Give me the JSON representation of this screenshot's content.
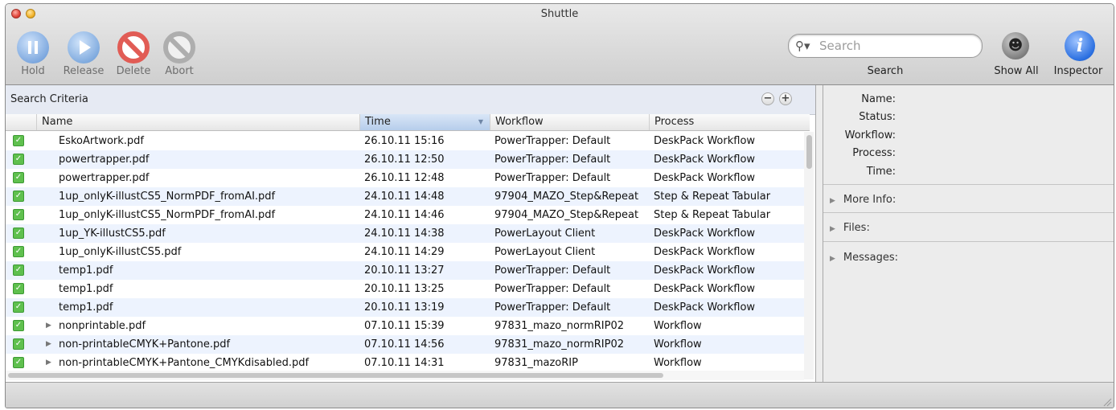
{
  "window": {
    "title": "Shuttle"
  },
  "toolbar": {
    "hold_label": "Hold",
    "release_label": "Release",
    "delete_label": "Delete",
    "abort_label": "Abort",
    "search_label": "Search",
    "search_placeholder": "Search",
    "show_all_label": "Show All",
    "inspector_label": "Inspector"
  },
  "search_criteria": {
    "label": "Search Criteria"
  },
  "table": {
    "columns": [
      "Name",
      "Time",
      "Workflow",
      "Process"
    ],
    "sorted_column": "Time",
    "rows": [
      {
        "checked": true,
        "expandable": false,
        "name": "EskoArtwork.pdf",
        "time": "26.10.11 15:16",
        "workflow": "PowerTrapper: Default",
        "process": "DeskPack Workflow"
      },
      {
        "checked": true,
        "expandable": false,
        "name": "powertrapper.pdf",
        "time": "26.10.11 12:50",
        "workflow": "PowerTrapper: Default",
        "process": "DeskPack Workflow"
      },
      {
        "checked": true,
        "expandable": false,
        "name": "powertrapper.pdf",
        "time": "26.10.11 12:48",
        "workflow": "PowerTrapper: Default",
        "process": "DeskPack Workflow"
      },
      {
        "checked": true,
        "expandable": false,
        "name": "1up_onlyK-illustCS5_NormPDF_fromAI.pdf",
        "time": "24.10.11 14:48",
        "workflow": "97904_MAZO_Step&Repeat",
        "process": "Step & Repeat Tabular"
      },
      {
        "checked": true,
        "expandable": false,
        "name": "1up_onlyK-illustCS5_NormPDF_fromAI.pdf",
        "time": "24.10.11 14:46",
        "workflow": "97904_MAZO_Step&Repeat",
        "process": "Step & Repeat Tabular"
      },
      {
        "checked": true,
        "expandable": false,
        "name": "1up_YK-illustCS5.pdf",
        "time": "24.10.11 14:38",
        "workflow": "PowerLayout Client",
        "process": "DeskPack Workflow"
      },
      {
        "checked": true,
        "expandable": false,
        "name": "1up_onlyK-illustCS5.pdf",
        "time": "24.10.11 14:29",
        "workflow": "PowerLayout Client",
        "process": "DeskPack Workflow"
      },
      {
        "checked": true,
        "expandable": false,
        "name": "temp1.pdf",
        "time": "20.10.11 13:27",
        "workflow": "PowerTrapper: Default",
        "process": "DeskPack Workflow"
      },
      {
        "checked": true,
        "expandable": false,
        "name": "temp1.pdf",
        "time": "20.10.11 13:25",
        "workflow": "PowerTrapper: Default",
        "process": "DeskPack Workflow"
      },
      {
        "checked": true,
        "expandable": false,
        "name": "temp1.pdf",
        "time": "20.10.11 13:19",
        "workflow": "PowerTrapper: Default",
        "process": "DeskPack Workflow"
      },
      {
        "checked": true,
        "expandable": true,
        "name": "nonprintable.pdf",
        "time": "07.10.11 15:39",
        "workflow": "97831_mazo_normRIP02",
        "process": "Workflow"
      },
      {
        "checked": true,
        "expandable": true,
        "name": "non-printableCMYK+Pantone.pdf",
        "time": "07.10.11 14:56",
        "workflow": "97831_mazo_normRIP02",
        "process": "Workflow"
      },
      {
        "checked": true,
        "expandable": true,
        "name": "non-printableCMYK+Pantone_CMYKdisabled.pdf",
        "time": "07.10.11 14:31",
        "workflow": "97831_mazoRIP",
        "process": "Workflow"
      }
    ]
  },
  "inspector": {
    "fields": [
      "Name:",
      "Status:",
      "Workflow:",
      "Process:",
      "Time:"
    ],
    "sections": [
      "More Info:",
      "Files:",
      "Messages:"
    ]
  },
  "icons": {
    "hold": "pause-icon",
    "release": "play-icon",
    "delete": "prohibited-red-icon",
    "abort": "prohibited-gray-icon",
    "search": "magnifier-icon",
    "show_all": "person-icon",
    "inspector": "info-icon"
  },
  "colors": {
    "check": "#5fc04e",
    "delete": "#e15c55",
    "inspector": "#2a6fe0",
    "row_alt": "#edf3fe",
    "sorted_header": "#b6cdeb"
  }
}
